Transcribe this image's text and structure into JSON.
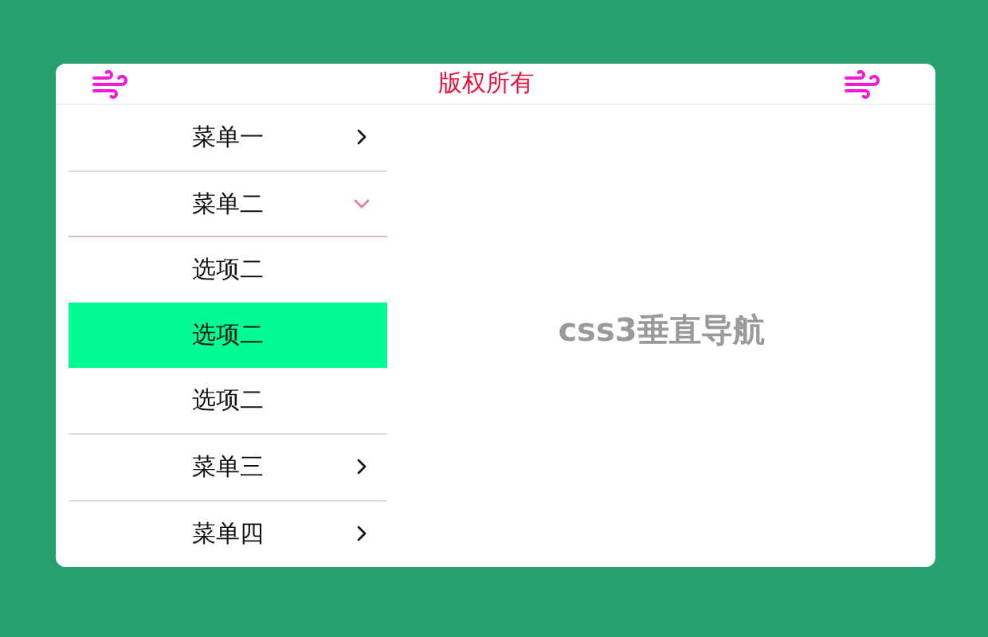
{
  "header": {
    "title": "版权所有"
  },
  "menu": [
    {
      "label": "菜单一",
      "expanded": false
    },
    {
      "label": "菜单二",
      "expanded": true,
      "children": [
        {
          "label": "选项二",
          "selected": false
        },
        {
          "label": "选项二",
          "selected": true
        },
        {
          "label": "选项二",
          "selected": false
        }
      ]
    },
    {
      "label": "菜单三",
      "expanded": false
    },
    {
      "label": "菜单四",
      "expanded": false
    }
  ],
  "content": {
    "heading": "css3垂直导航"
  }
}
